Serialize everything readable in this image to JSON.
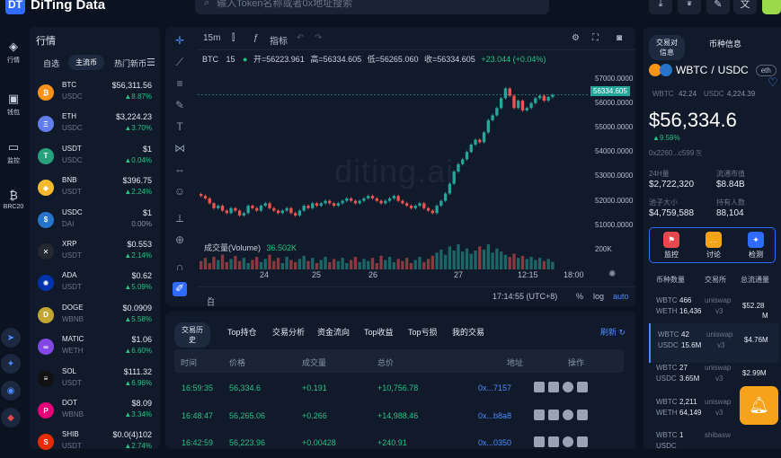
{
  "header": {
    "logo_mark": "DT",
    "app_name": "DiTing Data",
    "search_placeholder": "输入Token名称或者0x地址搜索"
  },
  "nav": [
    {
      "label": "行情",
      "icon": "layers-icon"
    },
    {
      "label": "钱包",
      "icon": "wallet-icon"
    },
    {
      "label": "监控",
      "icon": "monitor-icon"
    },
    {
      "label": "BRC20",
      "icon": "bitcoin-icon"
    }
  ],
  "market": {
    "title": "行情",
    "tabs": [
      "自选",
      "主流币",
      "热门新币"
    ],
    "rows": [
      {
        "sym": "BTC",
        "quote": "USDC",
        "price": "$56,311.56",
        "change": "▲8.87%",
        "color": "#f7931a",
        "glyph": "₿"
      },
      {
        "sym": "ETH",
        "quote": "USDC",
        "price": "$3,224.23",
        "change": "▲3.70%",
        "color": "#627eea",
        "glyph": "Ξ"
      },
      {
        "sym": "USDT",
        "quote": "USDC",
        "price": "$1",
        "change": "▲0.04%",
        "color": "#26a17b",
        "glyph": "T"
      },
      {
        "sym": "BNB",
        "quote": "USDT",
        "price": "$396.75",
        "change": "▲2.24%",
        "color": "#f3ba2f",
        "glyph": "◆"
      },
      {
        "sym": "USDC",
        "quote": "DAI",
        "price": "$1",
        "change": "0.00%",
        "color": "#2775ca",
        "glyph": "$"
      },
      {
        "sym": "XRP",
        "quote": "USDT",
        "price": "$0.553",
        "change": "▲2.14%",
        "color": "#23292f",
        "glyph": "✕"
      },
      {
        "sym": "ADA",
        "quote": "USDT",
        "price": "$0.62",
        "change": "▲5.09%",
        "color": "#0033ad",
        "glyph": "✺"
      },
      {
        "sym": "DOGE",
        "quote": "WBNB",
        "price": "$0.0909",
        "change": "▲5.58%",
        "color": "#c2a633",
        "glyph": "D"
      },
      {
        "sym": "MATIC",
        "quote": "WETH",
        "price": "$1.06",
        "change": "▲6.60%",
        "color": "#8247e5",
        "glyph": "∞"
      },
      {
        "sym": "SOL",
        "quote": "USDT",
        "price": "$111.32",
        "change": "▲6.96%",
        "color": "#111111",
        "glyph": "≡"
      },
      {
        "sym": "DOT",
        "quote": "WBNB",
        "price": "$8.09",
        "change": "▲3.34%",
        "color": "#e6007a",
        "glyph": "P"
      },
      {
        "sym": "SHIB",
        "quote": "USDT",
        "price": "$0.0(4)102",
        "change": "▲2.74%",
        "color": "#e42d04",
        "glyph": "S"
      }
    ]
  },
  "chart": {
    "interval": "15m",
    "indicator_label": "指标",
    "pair": "BTC",
    "tf": "15",
    "open": "开=56223.961",
    "high": "高=56334.605",
    "low": "低=56265.060",
    "close": "收=56334.605",
    "delta": "+23.044 (+0.04%)",
    "watermark": "diting.ai",
    "volume_label": "成交量(Volume)",
    "volume_value": "36.502K",
    "y_ticks": [
      "57000.0000",
      "56000.0000",
      "55000.0000",
      "54000.0000",
      "53000.0000",
      "52000.0000",
      "51000.0000"
    ],
    "price_tag": "56334.605",
    "vol_tick": "200K",
    "x_ticks": [
      "24",
      "25",
      "26",
      "27",
      "12:15",
      "18:00"
    ],
    "range_label": "日期范围",
    "time_label": "17:14:55 (UTC+8)",
    "pct": "%",
    "log": "log",
    "auto": "auto"
  },
  "chart_data": {
    "type": "candlestick",
    "title": "",
    "ylim": [
      50700,
      57500
    ],
    "closes": [
      52200,
      52100,
      51900,
      51700,
      51800,
      51600,
      51500,
      51700,
      51600,
      51400,
      51500,
      51800,
      51700,
      51600,
      51800,
      51900,
      51700,
      51600,
      51500,
      51600,
      51700,
      51500,
      51400,
      51600,
      51800,
      51700,
      51900,
      51800,
      51900,
      52000,
      51900,
      51800,
      51900,
      52000,
      52100,
      52000,
      51900,
      52000,
      52100,
      52200,
      52100,
      52000,
      51900,
      52000,
      52100,
      52200,
      52000,
      51900,
      51800,
      51700,
      51800,
      51900,
      51700,
      51600,
      51500,
      51800,
      52000,
      52300,
      52700,
      53200,
      53500,
      53700,
      54000,
      54300,
      54500,
      54400,
      54800,
      55300,
      55500,
      55800,
      56200,
      56600,
      56300,
      55800,
      56100,
      55700,
      55800,
      56000,
      56200,
      56300,
      56100,
      56250,
      56334.6
    ],
    "volume_max": 200000,
    "volumes": [
      40,
      55,
      30,
      60,
      45,
      70,
      35,
      50,
      65,
      40,
      55,
      30,
      45,
      60,
      35,
      50,
      70,
      40,
      55,
      30,
      60,
      45,
      35,
      50,
      65,
      40,
      55,
      30,
      45,
      60,
      35,
      50,
      40,
      55,
      30,
      45,
      60,
      35,
      50,
      40,
      55,
      30,
      65,
      45,
      60,
      35,
      50,
      40,
      55,
      30,
      45,
      60,
      35,
      50,
      65,
      80,
      95,
      70,
      110,
      90,
      120,
      85,
      100,
      75,
      90,
      110,
      95,
      120,
      80,
      100,
      85,
      70,
      60,
      75,
      55,
      65,
      50,
      60,
      45,
      55,
      40,
      50,
      36.5
    ]
  },
  "trades": {
    "tabs": [
      "交易历史",
      "Top持仓",
      "交易分析",
      "资金流向",
      "Top收益",
      "Top亏损",
      "我的交易"
    ],
    "refresh": "刷新",
    "headers": [
      "时间",
      "价格",
      "成交量",
      "总价",
      "地址",
      "操作"
    ],
    "rows": [
      {
        "time": "16:59:35",
        "price": "56,334.6",
        "vol": "+0.191",
        "total": "+10,756.78",
        "addr": "0x...7157"
      },
      {
        "time": "16:48:47",
        "price": "56,265.06",
        "vol": "+0.266",
        "total": "+14,988.46",
        "addr": "0x...b8a8"
      },
      {
        "time": "16:42:59",
        "price": "56,223.96",
        "vol": "+0.00428",
        "total": "+240.91",
        "addr": "0x...0350"
      }
    ]
  },
  "pairinfo": {
    "tabs": [
      "交易对信息",
      "币种信息"
    ],
    "base": "WBTC",
    "slash": "/",
    "quote": "USDC",
    "chain": "eth",
    "reserve_base_sym": "WBTC",
    "reserve_base": "42.24",
    "reserve_quote_sym": "USDC",
    "reserve_quote": "4,224.39",
    "price": "$56,334.6",
    "change": "▲9.59%",
    "address": "0x2260...c599",
    "stats": [
      {
        "label": "24H量",
        "value": "$2,722,320"
      },
      {
        "label": "流通市值",
        "value": "$8.84B"
      },
      {
        "label": "池子大小",
        "value": "$4,759,588"
      },
      {
        "label": "持有人数",
        "value": "88,104"
      }
    ],
    "actions": [
      {
        "label": "监控",
        "color": "#e5484d",
        "glyph": "⚑"
      },
      {
        "label": "讨论",
        "color": "#f7a21b",
        "glyph": "…"
      },
      {
        "label": "检测",
        "color": "#2f6bff",
        "glyph": "✦"
      }
    ],
    "pool_headers": [
      "币种数量",
      "交易所",
      "总流通量"
    ],
    "pools": [
      {
        "a_sym": "WBTC",
        "a_val": "466",
        "b_sym": "WETH",
        "b_val": "16,436",
        "dex": "uniswap",
        "ver": "v3",
        "tvl": "$52.28",
        "tvl2": "M"
      },
      {
        "a_sym": "WBTC",
        "a_val": "42",
        "b_sym": "USDC",
        "b_val": "15.6M",
        "dex": "uniswap",
        "ver": "v3",
        "tvl": "$4.76M",
        "tvl2": ""
      },
      {
        "a_sym": "WBTC",
        "a_val": "27",
        "b_sym": "USDC",
        "b_val": "3.65M",
        "dex": "uniswap",
        "ver": "v3",
        "tvl": "$2.99M",
        "tvl2": ""
      },
      {
        "a_sym": "WBTC",
        "a_val": "2,211",
        "b_sym": "WETH",
        "b_val": "64,149",
        "dex": "uniswap",
        "ver": "v3",
        "tvl": "",
        "tvl2": ""
      },
      {
        "a_sym": "WBTC",
        "a_val": "1",
        "b_sym": "USDC",
        "b_val": "",
        "dex": "shibasw",
        "ver": "",
        "tvl": "",
        "tvl2": ""
      }
    ]
  }
}
